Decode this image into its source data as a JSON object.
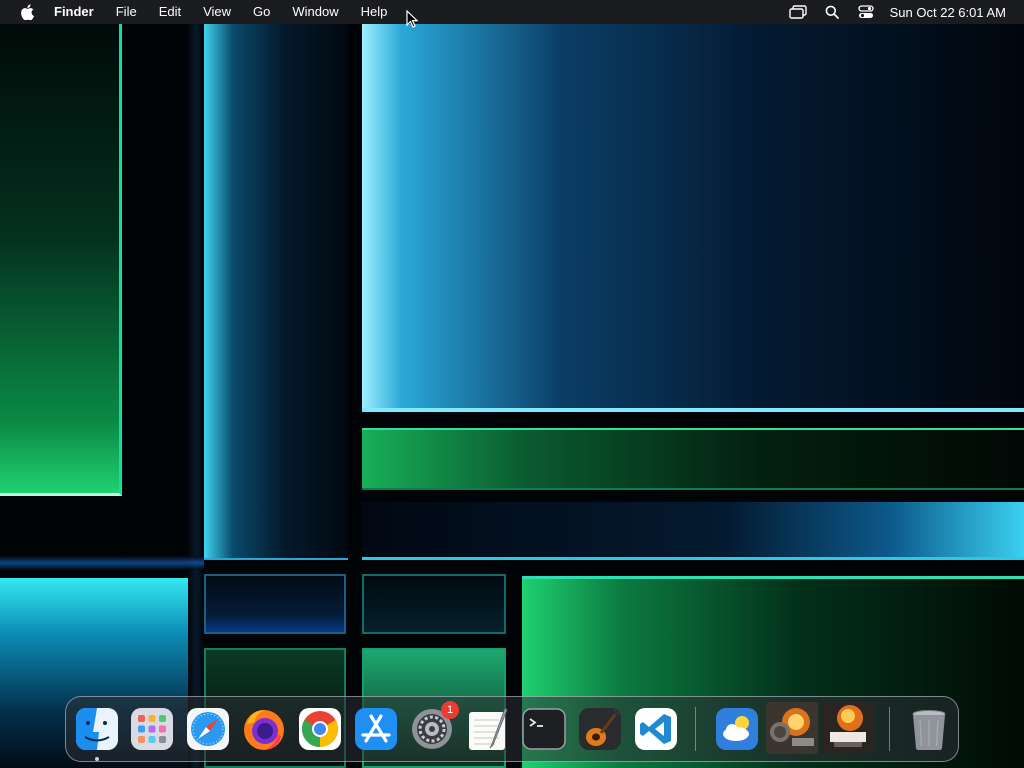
{
  "menubar": {
    "apple_icon": "apple-logo-icon",
    "app_name": "Finder",
    "items": [
      "File",
      "Edit",
      "View",
      "Go",
      "Window",
      "Help"
    ],
    "status_icons": [
      "screen-mirroring-icon",
      "spotlight-search-icon",
      "control-center-icon"
    ],
    "clock": "Sun Oct 22  6:01 AM"
  },
  "dock": {
    "apps": [
      {
        "name": "Finder",
        "icon": "finder-icon",
        "running": true
      },
      {
        "name": "Launchpad",
        "icon": "launchpad-icon"
      },
      {
        "name": "Safari",
        "icon": "safari-icon"
      },
      {
        "name": "Firefox",
        "icon": "firefox-icon"
      },
      {
        "name": "Google Chrome",
        "icon": "chrome-icon"
      },
      {
        "name": "App Store",
        "icon": "app-store-icon"
      },
      {
        "name": "System Settings",
        "icon": "system-settings-icon",
        "badge": "1"
      },
      {
        "name": "TextEdit",
        "icon": "textedit-icon"
      },
      {
        "name": "Terminal",
        "icon": "terminal-icon"
      },
      {
        "name": "GarageBand",
        "icon": "garageband-icon"
      },
      {
        "name": "Visual Studio Code",
        "icon": "vscode-icon"
      }
    ],
    "recents": [
      {
        "name": "Weather",
        "icon": "weather-icon"
      },
      {
        "name": "Recent item 1",
        "icon": "explosion-thumbnail-icon"
      },
      {
        "name": "Recent item 2",
        "icon": "explosion-thumbnail-icon"
      }
    ],
    "trash": {
      "name": "Trash",
      "icon": "trash-icon"
    }
  },
  "colors": {
    "menubar_bg": "#1b1c1f",
    "badge_red": "#ee3b2f",
    "wallpaper_cyan": "#3fd4f0",
    "wallpaper_green": "#20d070"
  }
}
